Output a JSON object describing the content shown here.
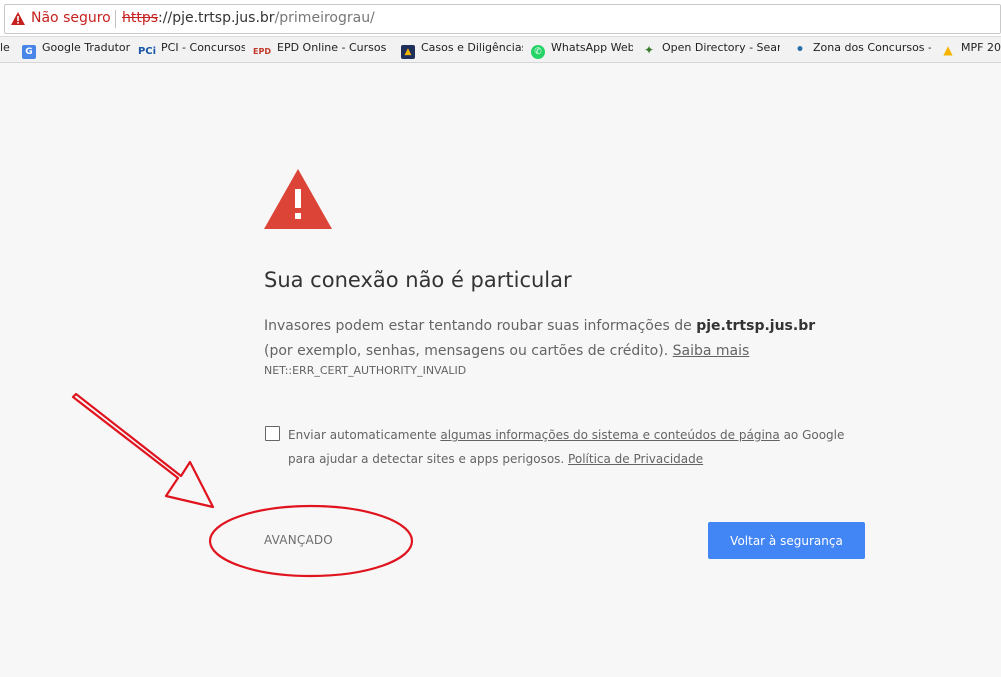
{
  "browser": {
    "security_label": "Não seguro",
    "url_scheme": "https",
    "url_host": "://pje.trtsp.jus.br",
    "url_path": "/primeirograu/"
  },
  "bookmarks": [
    {
      "label": "le",
      "icon": "partial-icon"
    },
    {
      "label": "Google Tradutor",
      "icon": "google-translate-icon",
      "icon_text": "G",
      "color": "#4a86e8"
    },
    {
      "label": "PCI - Concursos",
      "icon": "pci-icon",
      "icon_text": "PCi",
      "color": "#1a57a6"
    },
    {
      "label": "EPD Online - Cursos de",
      "icon": "epd-icon",
      "icon_text": "EPD",
      "color": "#c0392b"
    },
    {
      "label": "Casos e Diligências",
      "icon": "adwords-icon",
      "icon_text": "▲",
      "color": "#1e2f5a"
    },
    {
      "label": "WhatsApp Web",
      "icon": "whatsapp-icon",
      "icon_text": "✆",
      "color": "#25d366"
    },
    {
      "label": "Open Directory - Searc",
      "icon": "open-directory-icon",
      "icon_text": "✦",
      "color": "#3b7a2e"
    },
    {
      "label": "Zona dos Concursos - /",
      "icon": "zona-icon",
      "icon_text": "•",
      "color": "#2a6fa8"
    },
    {
      "label": "MPF 20",
      "icon": "drive-icon",
      "icon_text": "▲",
      "color": "#f4b400"
    }
  ],
  "interstitial": {
    "heading": "Sua conexão não é particular",
    "text_before": "Invasores podem estar tentando roubar suas informações de ",
    "domain": "pje.trtsp.jus.br",
    "text_after": " (por exemplo, senhas, mensagens ou cartões de crédito). ",
    "learn_more": "Saiba mais",
    "error_code": "NET::ERR_CERT_AUTHORITY_INVALID",
    "report_text_1": "Enviar automaticamente ",
    "report_link": "algumas informações do sistema e conteúdos de página",
    "report_text_2": " ao Google para ajudar a detectar sites e apps perigosos. ",
    "privacy_link": "Política de Privacidade",
    "advanced_label": "AVANÇADO",
    "back_label": "Voltar à segurança"
  },
  "colors": {
    "danger": "#db4437",
    "button": "#4285f4",
    "annotation": "#e0141e"
  }
}
